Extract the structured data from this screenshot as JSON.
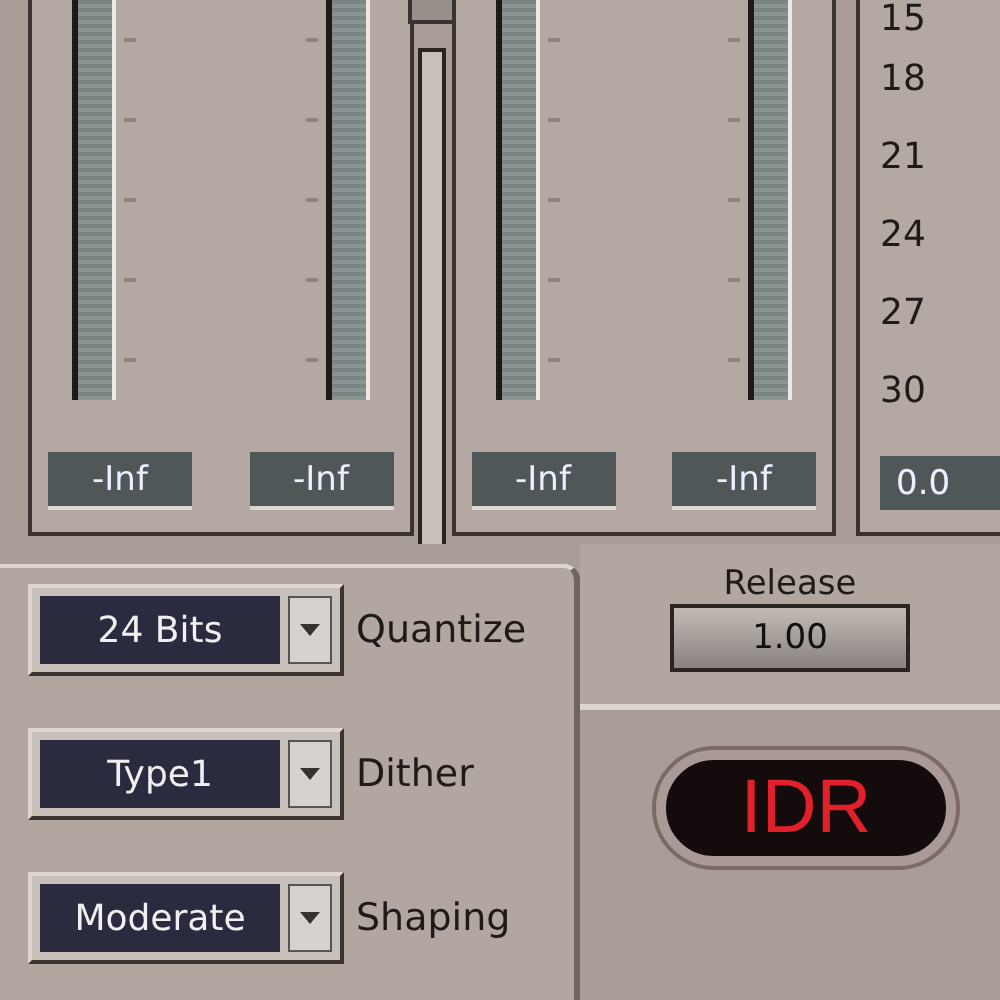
{
  "meter_groups": [
    {
      "channels": [
        {
          "reading": "-Inf"
        },
        {
          "reading": "-Inf"
        }
      ]
    },
    {
      "channels": [
        {
          "reading": "-Inf"
        },
        {
          "reading": "-Inf"
        }
      ]
    }
  ],
  "scale": {
    "labels": [
      "15",
      "18",
      "21",
      "24",
      "27",
      "30"
    ],
    "reading": "0.0"
  },
  "dropdowns": [
    {
      "value": "24 Bits",
      "label": "Quantize"
    },
    {
      "value": "Type1",
      "label": "Dither"
    },
    {
      "value": "Moderate",
      "label": "Shaping"
    }
  ],
  "release": {
    "label": "Release",
    "value": "1.00"
  },
  "idr_button": {
    "label": "IDR"
  }
}
